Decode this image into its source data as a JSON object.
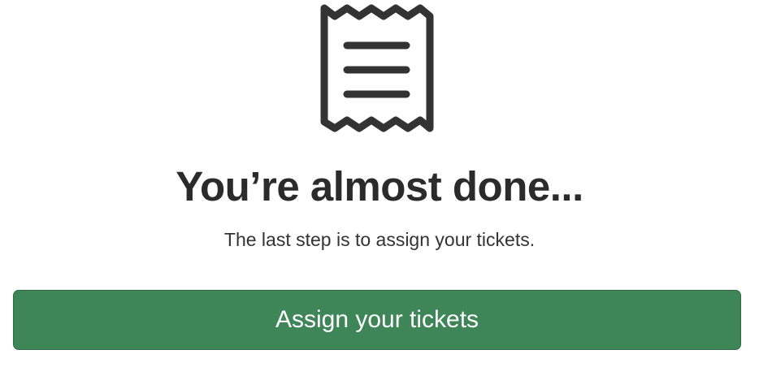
{
  "icon": "receipt-icon",
  "heading": "You’re almost done...",
  "subheading": "The last step is to assign your tickets.",
  "primary_button": {
    "label": "Assign your tickets",
    "color": "#3e8657"
  },
  "colors": {
    "text": "#2b2b2b",
    "icon": "#333333"
  }
}
